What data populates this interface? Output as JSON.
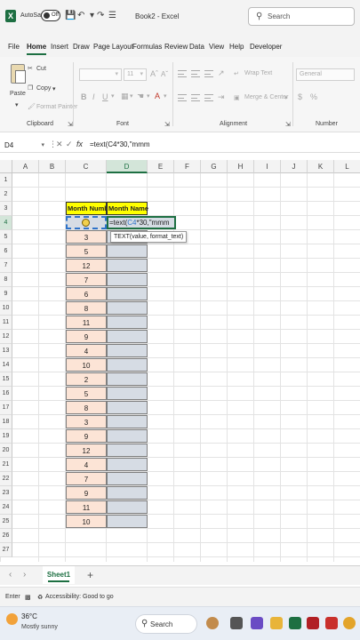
{
  "titlebar": {
    "autosave_label": "AutoSave",
    "autosave_state": "Off",
    "doc_title": "Book2 - Excel",
    "search_placeholder": "Search"
  },
  "menu": [
    "File",
    "Home",
    "Insert",
    "Draw",
    "Page Layout",
    "Formulas",
    "Review",
    "Data",
    "View",
    "Help",
    "Developer"
  ],
  "menu_active": "Home",
  "ribbon": {
    "paste": "Paste",
    "cut": "Cut",
    "copy": "Copy",
    "format_painter": "Format Painter",
    "clipboard": "Clipboard",
    "font_size": "11",
    "font_group": "Font",
    "wrap_text": "Wrap Text",
    "merge_center": "Merge & Center",
    "alignment_group": "Alignment",
    "number_format": "General",
    "number_group": "Number"
  },
  "formula_bar": {
    "name_box": "D4",
    "formula": "=text(C4*30,\"mmm"
  },
  "columns": [
    "A",
    "B",
    "C",
    "D",
    "E",
    "F",
    "G",
    "H",
    "I",
    "J",
    "K",
    "L"
  ],
  "selected_column": "D",
  "rows": [
    "1",
    "2",
    "3",
    "4",
    "5",
    "6",
    "7",
    "8",
    "9",
    "10",
    "11",
    "12",
    "13",
    "14",
    "15",
    "16",
    "17",
    "18",
    "19",
    "20",
    "21",
    "22",
    "23",
    "24",
    "25",
    "26",
    "27"
  ],
  "selected_row": "4",
  "table": {
    "header_month_number": "Month Number",
    "header_month_name": "Month Name",
    "month_numbers": [
      "6",
      "3",
      "5",
      "12",
      "7",
      "6",
      "8",
      "11",
      "9",
      "4",
      "10",
      "2",
      "5",
      "8",
      "3",
      "9",
      "12",
      "4",
      "7",
      "9",
      "11",
      "10"
    ]
  },
  "edit_cell": {
    "prefix": "=text(",
    "ref": "C4",
    "suffix": "*30,\"mmm"
  },
  "tooltip": "TEXT(value, format_text)",
  "sheet_tab": "Sheet1",
  "status": {
    "mode": "Enter",
    "accessibility": "Accessibility: Good to go"
  },
  "taskbar": {
    "temperature": "36°C",
    "weather": "Mostly sunny",
    "search": "Search"
  },
  "colors": {
    "excel_green": "#1d6f42",
    "header_yellow": "#ffff00",
    "peach": "#fce4d6",
    "blue_gray": "#d6dce4"
  }
}
